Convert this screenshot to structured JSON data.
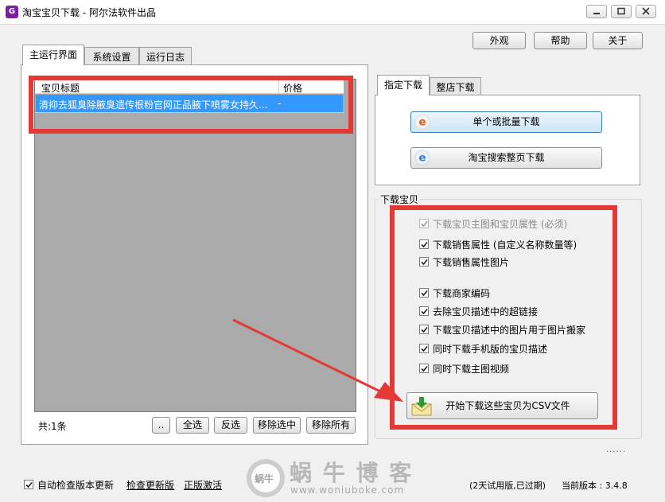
{
  "window": {
    "title": "淘宝宝贝下载 - 阿尔法软件出品",
    "icon_letter": "G"
  },
  "top_buttons": {
    "appearance": "外观",
    "help": "帮助",
    "about": "关于"
  },
  "left_tabs": [
    "主运行界面",
    "系统设置",
    "运行日志"
  ],
  "list": {
    "columns": [
      "宝贝标题",
      "价格"
    ],
    "rows": [
      {
        "title": "清抑去狐臭除腋臭遗传根粉官网正品腋下喷雾女持久...",
        "price": "-"
      }
    ],
    "count_label": "共:1条"
  },
  "list_buttons": [
    "..",
    "全选",
    "反选",
    "移除选中",
    "移除所有"
  ],
  "right_tabs": [
    "指定下载",
    "整店下载"
  ],
  "download_buttons": [
    "单个或批量下载",
    "淘宝搜索整页下载"
  ],
  "group": {
    "title": "下载宝贝",
    "options": [
      {
        "label": "下载宝贝主图和宝贝属性 (必须)",
        "checked": true,
        "disabled": true
      },
      {
        "label": "下载销售属性 (自定义名称数量等)",
        "checked": true,
        "disabled": false
      },
      {
        "label": "下载销售属性图片",
        "checked": true,
        "disabled": false
      },
      {
        "label": "下载商家编码",
        "checked": true,
        "disabled": false
      },
      {
        "label": "去除宝贝描述中的超链接",
        "checked": true,
        "disabled": false
      },
      {
        "label": "下载宝贝描述中的图片用于图片搬家",
        "checked": true,
        "disabled": false
      },
      {
        "label": "同时下载手机版的宝贝描述",
        "checked": true,
        "disabled": false
      },
      {
        "label": "同时下载主图视频",
        "checked": true,
        "disabled": false
      }
    ],
    "start_button": "开始下载这些宝贝为CSV文件"
  },
  "footer": {
    "auto_check_label": "自动检查版本更新",
    "auto_check_checked": true,
    "check_update_link": "检查更新版",
    "activate_link": "正版激活",
    "trial_status": "(2天试用版,已过期)",
    "version": "当前版本 : 3.4.8",
    "dots": "......"
  },
  "watermark": {
    "text": "蜗 牛 博 客",
    "url": "www.woniuboke.com",
    "logo_text": "蜗牛"
  },
  "colors": {
    "highlight_red": "#e53935",
    "selection_blue": "#3399ff",
    "list_gray": "#aaaaaa"
  }
}
